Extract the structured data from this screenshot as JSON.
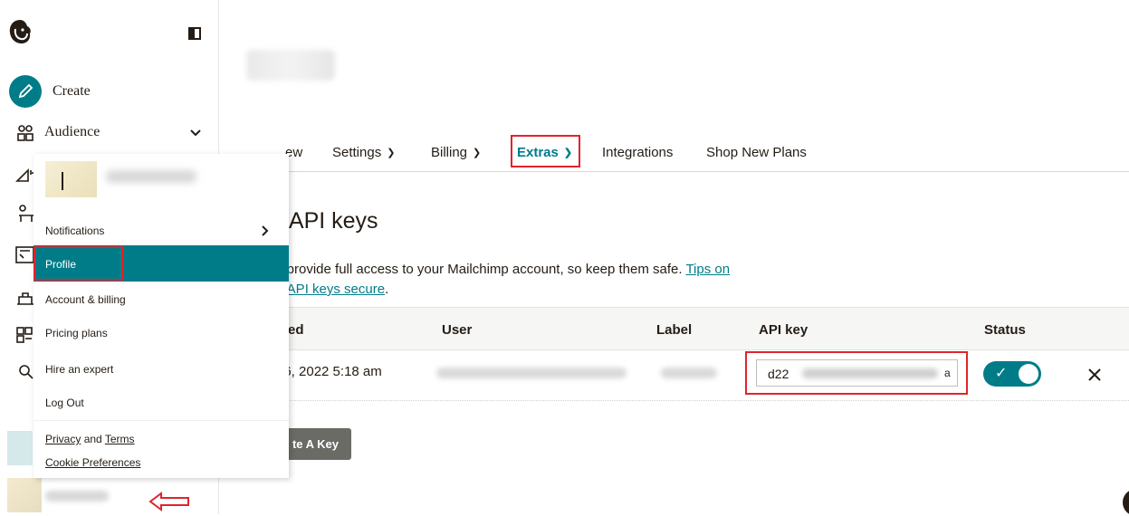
{
  "nav": {
    "create_label": "Create",
    "audience_label": "Audience"
  },
  "tabs": [
    {
      "label": "ew"
    },
    {
      "label": "Settings"
    },
    {
      "label": "Billing"
    },
    {
      "label": "Extras"
    },
    {
      "label": "Integrations"
    },
    {
      "label": "Shop New Plans"
    }
  ],
  "page": {
    "heading": "r API keys",
    "description_text": "s provide full access to your Mailchimp account, so keep them safe. ",
    "link_part1": "Tips on",
    "link_part2": "g API keys secure",
    "description_end": "."
  },
  "table": {
    "headers": [
      "ted",
      "User",
      "Label",
      "API key",
      "Status"
    ],
    "row": {
      "created": "26, 2022 5:18 am",
      "api_key_start": "d22",
      "api_key_end": "a"
    },
    "create_button": "te A Key"
  },
  "menu": {
    "notifications": "Notifications",
    "profile": "Profile",
    "account_billing": "Account & billing",
    "pricing_plans": "Pricing plans",
    "hire_expert": "Hire an expert",
    "log_out": "Log Out",
    "privacy": "Privacy",
    "and": "and",
    "terms": "Terms",
    "cookie_prefs": "Cookie Preferences"
  },
  "colors": {
    "accent": "#007c89",
    "highlight": "#e0242c"
  }
}
